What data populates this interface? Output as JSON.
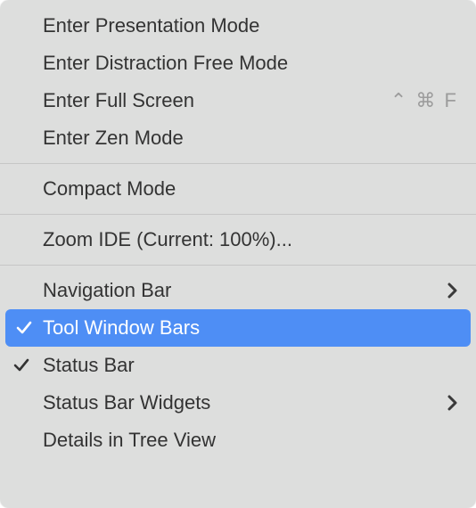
{
  "menu": {
    "groups": [
      {
        "items": [
          {
            "id": "enter-presentation-mode",
            "label": "Enter Presentation Mode",
            "checked": false,
            "shortcut": "",
            "submenu": false
          },
          {
            "id": "enter-distraction-free-mode",
            "label": "Enter Distraction Free Mode",
            "checked": false,
            "shortcut": "",
            "submenu": false
          },
          {
            "id": "enter-full-screen",
            "label": "Enter Full Screen",
            "checked": false,
            "shortcut": "⌃ ⌘ F",
            "submenu": false
          },
          {
            "id": "enter-zen-mode",
            "label": "Enter Zen Mode",
            "checked": false,
            "shortcut": "",
            "submenu": false
          }
        ]
      },
      {
        "items": [
          {
            "id": "compact-mode",
            "label": "Compact Mode",
            "checked": false,
            "shortcut": "",
            "submenu": false
          }
        ]
      },
      {
        "items": [
          {
            "id": "zoom-ide",
            "label": "Zoom IDE (Current: 100%)...",
            "checked": false,
            "shortcut": "",
            "submenu": false
          }
        ]
      },
      {
        "items": [
          {
            "id": "navigation-bar",
            "label": "Navigation Bar",
            "checked": false,
            "shortcut": "",
            "submenu": true
          },
          {
            "id": "tool-window-bars",
            "label": "Tool Window Bars",
            "checked": true,
            "shortcut": "",
            "submenu": false,
            "highlighted": true
          },
          {
            "id": "status-bar",
            "label": "Status Bar",
            "checked": true,
            "shortcut": "",
            "submenu": false
          },
          {
            "id": "status-bar-widgets",
            "label": "Status Bar Widgets",
            "checked": false,
            "shortcut": "",
            "submenu": true
          },
          {
            "id": "details-in-tree-view",
            "label": "Details in Tree View",
            "checked": false,
            "shortcut": "",
            "submenu": false
          }
        ]
      }
    ]
  }
}
